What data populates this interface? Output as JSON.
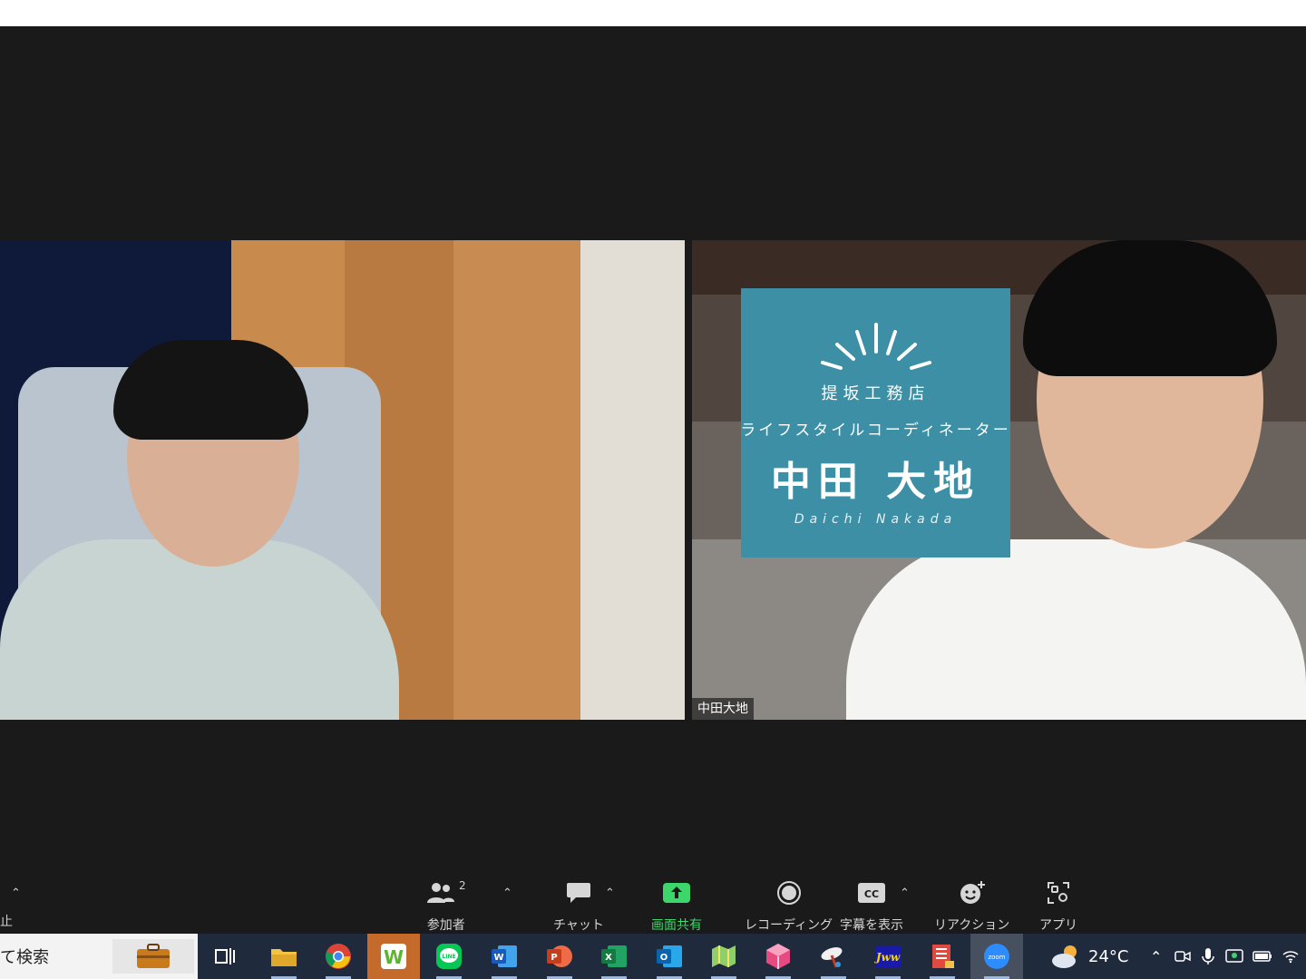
{
  "participants": [
    {
      "id": "left",
      "name": ""
    },
    {
      "id": "right",
      "name": "中田大地"
    }
  ],
  "virtual_background": {
    "company": "提坂工務店",
    "role": "ライフスタイルコーディネーター",
    "name": "中田 大地",
    "romaji": "Daichi Nakada",
    "color": "#3d8fa5"
  },
  "toolbar": {
    "edge_label": "止",
    "participants_count": "2",
    "buttons": {
      "participants": "参加者",
      "chat": "チャット",
      "share": "画面共有",
      "record": "レコーディング",
      "captions": "字幕を表示",
      "reactions": "リアクション",
      "apps": "アプリ"
    },
    "share_color": "#3dd66b"
  },
  "taskbar": {
    "search_text": "て検索",
    "weather_temp": "24°C"
  },
  "icons": [
    "people-icon",
    "chat-bubble-icon",
    "share-arrow-icon",
    "record-icon",
    "cc-icon",
    "reaction-icon",
    "apps-icon",
    "chevron-up-icon",
    "briefcase-icon",
    "task-view-icon",
    "file-explorer-icon",
    "chrome-icon",
    "w-app-icon",
    "line-icon",
    "word-icon",
    "powerpoint-icon",
    "excel-icon",
    "outlook-icon",
    "map-app-icon",
    "cube-app-icon",
    "satellite-app-icon",
    "jww-icon",
    "document-app-icon",
    "zoom-icon",
    "weather-icon",
    "wifi-icon",
    "battery-icon",
    "microphone-icon",
    "camera-icon"
  ]
}
